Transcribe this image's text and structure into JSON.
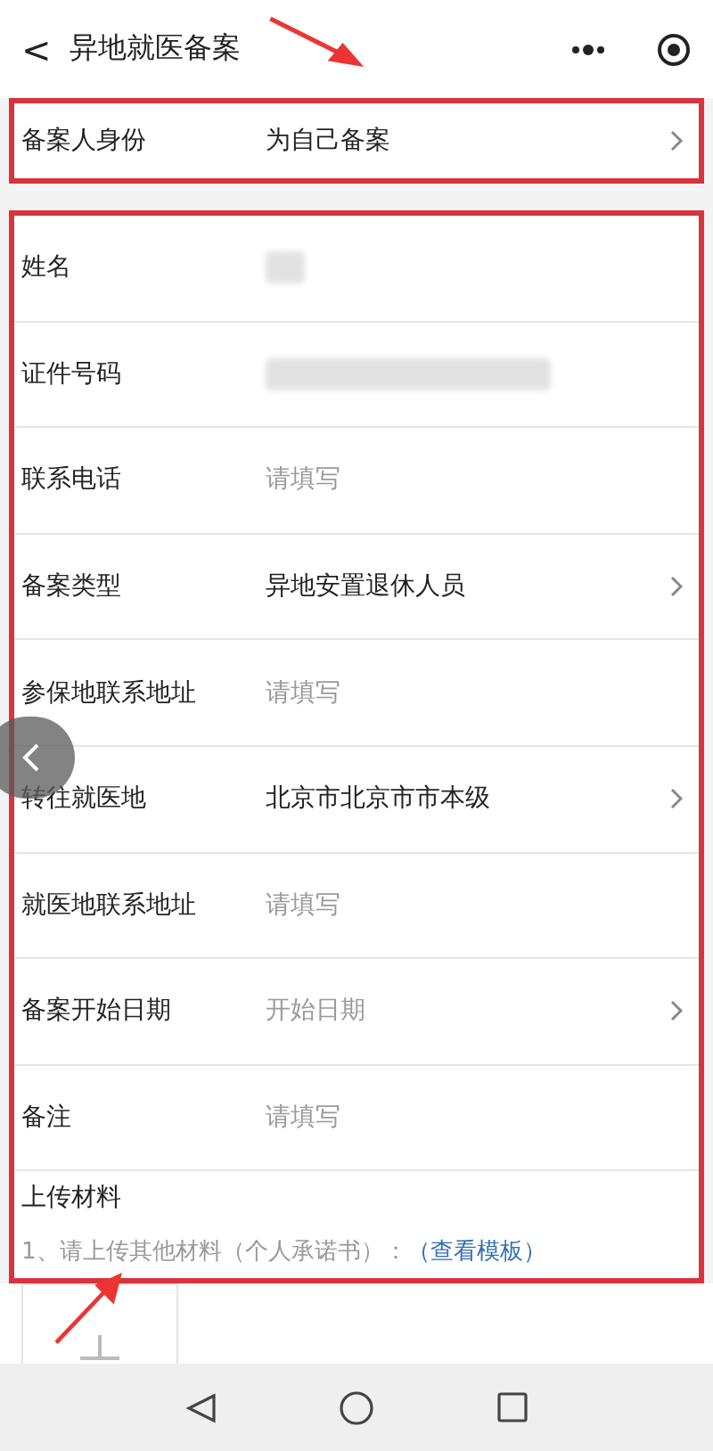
{
  "header": {
    "back": "<",
    "title": "异地就医备案"
  },
  "identity": {
    "label": "备案人身份",
    "value": "为自己备案",
    "chevron": true
  },
  "rows": [
    {
      "label": "姓名",
      "kind": "redacted",
      "chevron": false
    },
    {
      "label": "证件号码",
      "kind": "redacted",
      "chevron": false
    },
    {
      "label": "联系电话",
      "kind": "placeholder",
      "placeholder": "请填写",
      "chevron": false
    },
    {
      "label": "备案类型",
      "kind": "value",
      "value": "异地安置退休人员",
      "chevron": true
    },
    {
      "label": "参保地联系地址",
      "kind": "placeholder",
      "placeholder": "请填写",
      "chevron": false
    },
    {
      "label": "转往就医地",
      "kind": "value",
      "value": "北京市北京市市本级",
      "chevron": true
    },
    {
      "label": "就医地联系地址",
      "kind": "placeholder",
      "placeholder": "请填写",
      "chevron": false
    },
    {
      "label": "备案开始日期",
      "kind": "placeholder",
      "placeholder": "开始日期",
      "chevron": true
    },
    {
      "label": "备注",
      "kind": "placeholder",
      "placeholder": "请填写",
      "chevron": false
    }
  ],
  "upload": {
    "title": "上传材料",
    "hint": "1、请上传其他材料（个人承诺书）：",
    "link": "（查看模板）"
  }
}
